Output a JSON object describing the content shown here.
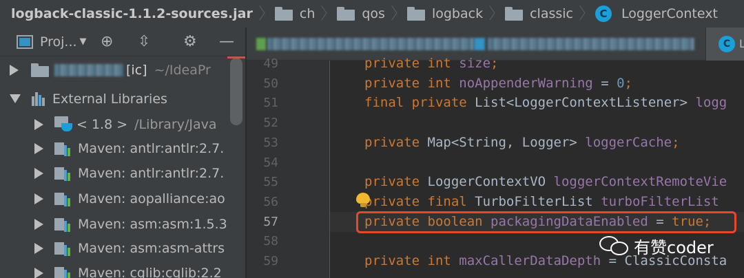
{
  "breadcrumb": {
    "jar": "logback-classic-1.1.2-sources.jar",
    "folders": [
      "ch",
      "qos",
      "logback",
      "classic"
    ],
    "class_name": "LoggerContext",
    "class_icon": "C"
  },
  "project_panel": {
    "title": "Proj...",
    "tree": {
      "root_badge": "[ic]",
      "root_path": "~/IdeaPr",
      "external_libraries": "External Libraries",
      "jdk_label": "< 1.8 >",
      "jdk_path": "/Library/Java",
      "maven_items": [
        "Maven: antlr:antlr:2.7.",
        "Maven: antlr:antlr:2.7.",
        "Maven: aopalliance:ao",
        "Maven: asm:asm:1.5.3",
        "Maven: asm:asm-attrs",
        "Maven: cglib:cglib:2.2"
      ]
    }
  },
  "tabs": {
    "active_icon": "C",
    "active_label": "L"
  },
  "editor": {
    "lines": [
      {
        "num": "49",
        "tokens": [
          {
            "t": "private int ",
            "c": "kw"
          },
          {
            "t": "size",
            "c": "fld"
          },
          {
            "t": ";",
            "c": "kw"
          }
        ]
      },
      {
        "num": "50",
        "tokens": [
          {
            "t": "private int ",
            "c": "kw"
          },
          {
            "t": "noAppenderWarning",
            "c": "fld"
          },
          {
            "t": " = ",
            "c": ""
          },
          {
            "t": "0",
            "c": "num"
          },
          {
            "t": ";",
            "c": "kw"
          }
        ]
      },
      {
        "num": "51",
        "tokens": [
          {
            "t": "final private ",
            "c": "kw"
          },
          {
            "t": "List<LoggerContextListener> ",
            "c": ""
          },
          {
            "t": "logg",
            "c": "fld"
          }
        ]
      },
      {
        "num": "52",
        "tokens": []
      },
      {
        "num": "53",
        "tokens": [
          {
            "t": "private ",
            "c": "kw"
          },
          {
            "t": "Map<String, Logger> ",
            "c": ""
          },
          {
            "t": "loggerCache",
            "c": "fld"
          },
          {
            "t": ";",
            "c": "kw"
          }
        ]
      },
      {
        "num": "54",
        "tokens": []
      },
      {
        "num": "55",
        "tokens": [
          {
            "t": "private ",
            "c": "kw"
          },
          {
            "t": "LoggerContextVO ",
            "c": ""
          },
          {
            "t": "loggerContextRemoteVie",
            "c": "fld"
          }
        ]
      },
      {
        "num": "56",
        "tokens": [
          {
            "t": "private final ",
            "c": "kw"
          },
          {
            "t": "TurboFilterList ",
            "c": ""
          },
          {
            "t": "turboFilterList",
            "c": "fld"
          }
        ]
      },
      {
        "num": "57",
        "tokens": [
          {
            "t": "private boolean ",
            "c": "kw"
          },
          {
            "t": "packagingDataEnabled",
            "c": "fld"
          },
          {
            "t": " = ",
            "c": ""
          },
          {
            "t": "true",
            "c": "kw"
          },
          {
            "t": ";",
            "c": "kw"
          }
        ]
      },
      {
        "num": "58",
        "tokens": []
      },
      {
        "num": "59",
        "tokens": [
          {
            "t": "private int ",
            "c": "kw"
          },
          {
            "t": "maxCallerDataDepth",
            "c": "fld"
          },
          {
            "t": " = ",
            "c": ""
          },
          {
            "t": "ClassicConsta",
            "c": ""
          }
        ]
      }
    ],
    "current_line": "57"
  },
  "watermark": {
    "text": "有赞coder"
  },
  "colors": {
    "highlight_box": "#e8482a",
    "keyword": "#cc7832",
    "field": "#9876aa",
    "number": "#6897bb",
    "text": "#a9b7c6"
  }
}
